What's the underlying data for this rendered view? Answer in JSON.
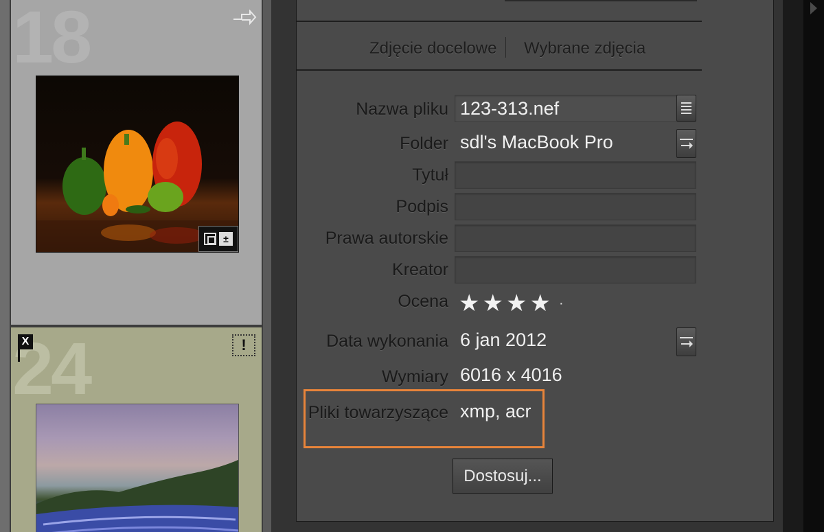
{
  "grid": {
    "cell_top": {
      "number": "18",
      "bg": "#a6a6a6",
      "number_color": "#b5b5b5"
    },
    "cell_bottom": {
      "number": "24",
      "bg": "#a7a98a",
      "number_color": "#b9bb9f",
      "flag_label": "X",
      "warning_label": "!"
    }
  },
  "panel": {
    "tabs": [
      "Zdjęcie docelowe",
      "Wybrane zdjęcia"
    ],
    "fields": {
      "filename": {
        "label": "Nazwa pliku",
        "value": "123-313.nef"
      },
      "folder": {
        "label": "Folder",
        "value": "sdl's MacBook Pro"
      },
      "title": {
        "label": "Tytuł",
        "value": ""
      },
      "caption": {
        "label": "Podpis",
        "value": ""
      },
      "copyright": {
        "label": "Prawa autorskie",
        "value": ""
      },
      "creator": {
        "label": "Kreator",
        "value": ""
      },
      "rating": {
        "label": "Ocena",
        "value": 4,
        "max": 5
      },
      "date": {
        "label": "Data wykonania",
        "value": "6 jan 2012"
      },
      "dimensions": {
        "label": "Wymiary",
        "value": "6016 x 4016"
      },
      "sidecars": {
        "label": "Pliki towarzyszące",
        "value": "xmp, acr"
      }
    },
    "customize_button": "Dostosuj...",
    "highlight_color": "#e8843a"
  }
}
